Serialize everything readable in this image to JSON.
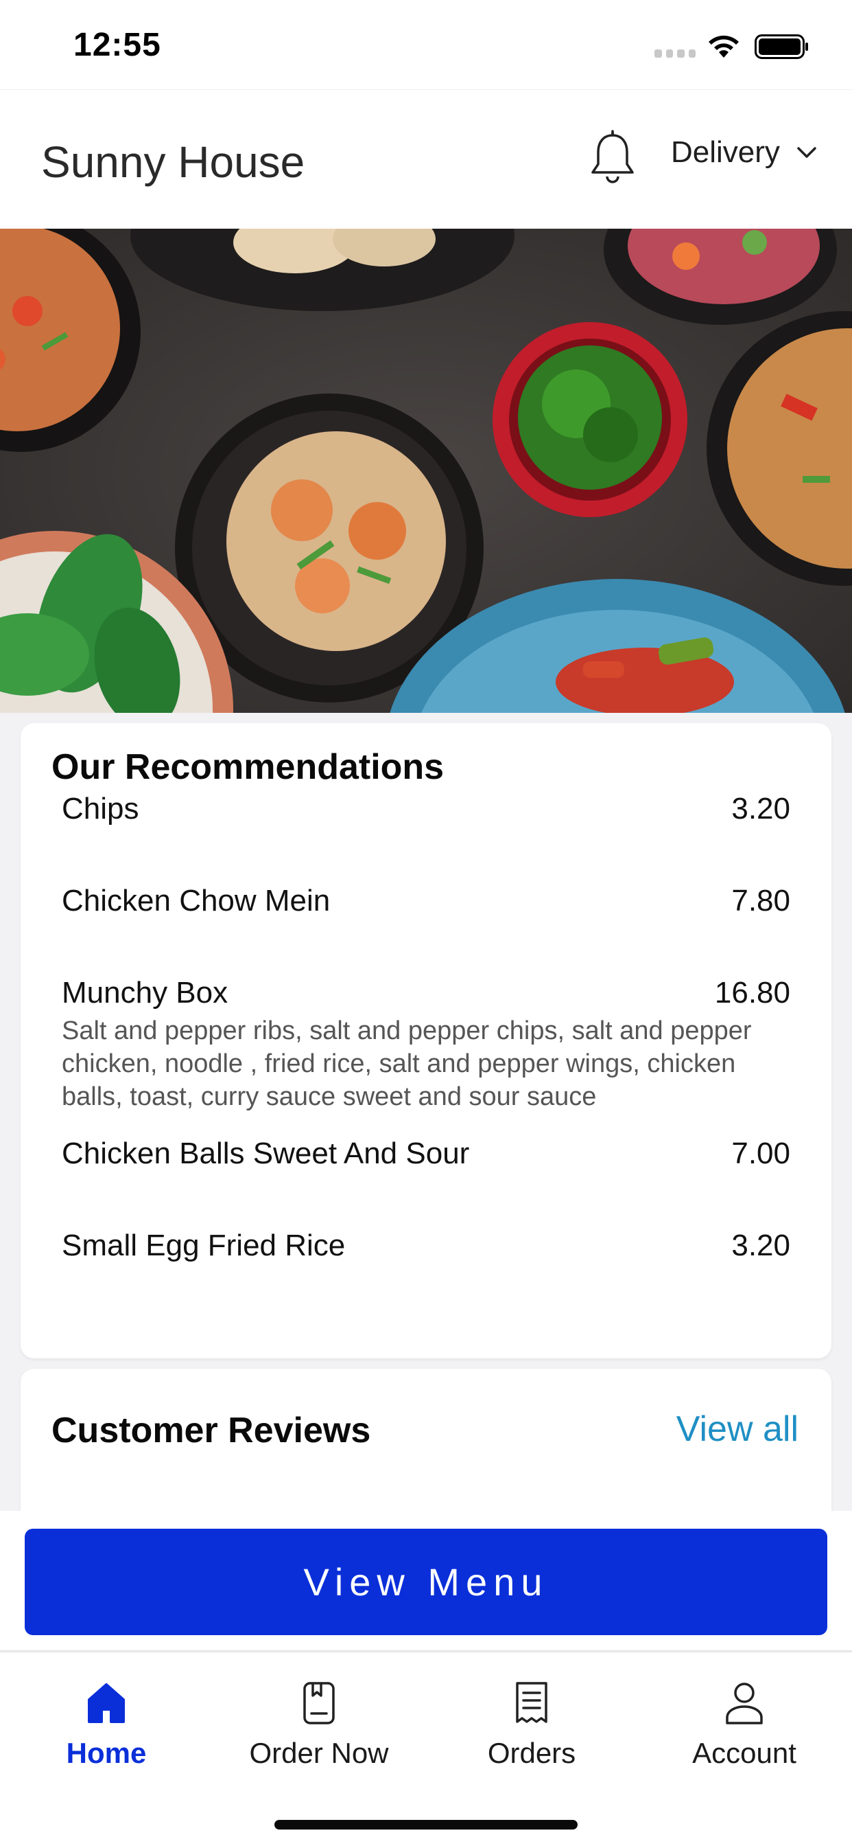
{
  "status_bar": {
    "time": "12:55"
  },
  "header": {
    "title": "Sunny House",
    "delivery_mode": "Delivery"
  },
  "hero": {
    "image": "chinese-food-bowls-photo"
  },
  "recommendations": {
    "heading": "Our Recommendations",
    "items": [
      {
        "name": "Chips",
        "price": "3.20",
        "description": ""
      },
      {
        "name": "Chicken Chow Mein",
        "price": "7.80",
        "description": ""
      },
      {
        "name": "Munchy Box",
        "price": "16.80",
        "description": "Salt and pepper ribs, salt and pepper chips, salt and pepper chicken, noodle , fried rice, salt and pepper wings, chicken balls, toast, curry sauce sweet and sour sauce"
      },
      {
        "name": "Chicken Balls Sweet And Sour",
        "price": "7.00",
        "description": ""
      },
      {
        "name": "Small Egg Fried Rice",
        "price": "3.20",
        "description": ""
      }
    ]
  },
  "reviews": {
    "heading": "Customer Reviews",
    "view_all_label": "View all"
  },
  "actions": {
    "view_menu_label": "View Menu"
  },
  "tab_bar": {
    "tabs": [
      {
        "label": "Home",
        "icon": "home-icon",
        "active": true
      },
      {
        "label": "Order Now",
        "icon": "order-book-icon",
        "active": false
      },
      {
        "label": "Orders",
        "icon": "receipt-icon",
        "active": false
      },
      {
        "label": "Account",
        "icon": "person-icon",
        "active": false
      }
    ]
  },
  "colors": {
    "primary": "#0a2fd9",
    "link": "#1f8fc4",
    "text": "#111111",
    "muted_text": "#555555",
    "page_background": "#f2f2f4"
  }
}
